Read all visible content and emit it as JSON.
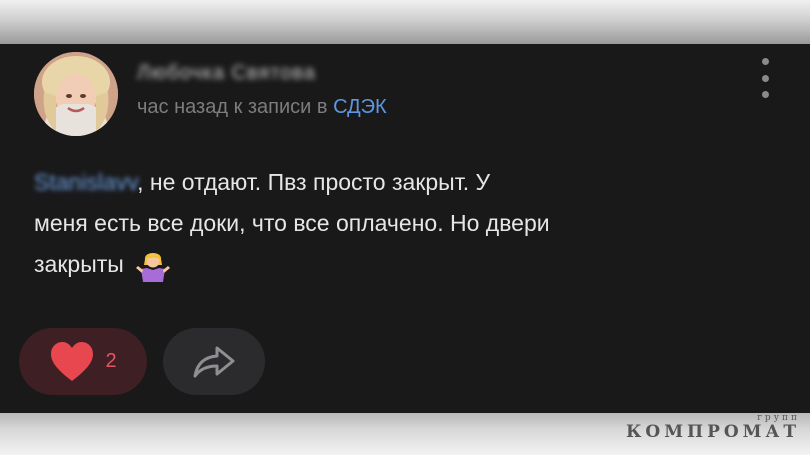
{
  "comment": {
    "author_name": "Любочка Святова",
    "meta_time": "час назад к записи в ",
    "meta_link": "СДЭК",
    "mention": "Stanislavv",
    "text_line1": ", не отдают. Пвз просто закрыт. У",
    "text_line2": "меня есть все доки, что все оплачено. Но двери",
    "text_line3": "закрыты",
    "emoji": "person-shrugging-emoji",
    "likes": "2"
  },
  "watermark": {
    "top": "групп",
    "main": "КОМПРОМАТ"
  },
  "colors": {
    "card_bg": "#19191a",
    "link": "#5d97e0",
    "like_red": "#e2585f",
    "like_bg": "#3d1f24",
    "share_bg": "#2b2b2e"
  }
}
